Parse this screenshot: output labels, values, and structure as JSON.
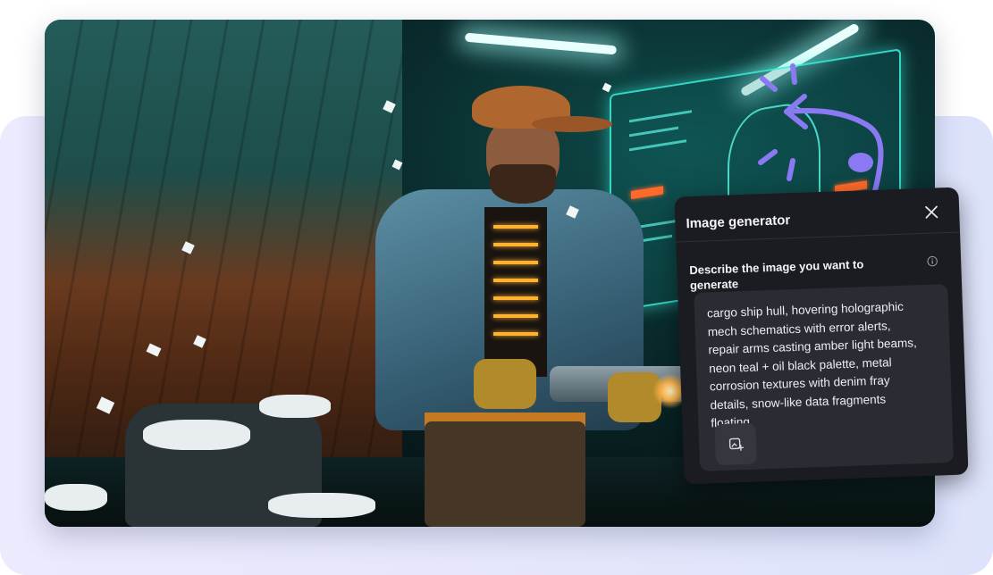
{
  "dialog": {
    "title": "Image generator",
    "prompt_label": "Describe the image you want to generate",
    "prompt_text": "cargo ship hull, hovering holographic\nmech schematics with error alerts,\nrepair arms casting amber light beams,\nneon teal + oil black palette, metal\ncorrosion textures with denim fray\ndetails, snow-like data fragments\nfloating."
  },
  "icons": {
    "close": "close-icon",
    "info": "info-icon",
    "upload": "image-upload-icon"
  },
  "colors": {
    "panel_bg": "#1b1c21",
    "field_bg": "#2b2c33",
    "accent_arrow": "#8a79f2",
    "backdrop": "#e4e6fb"
  }
}
